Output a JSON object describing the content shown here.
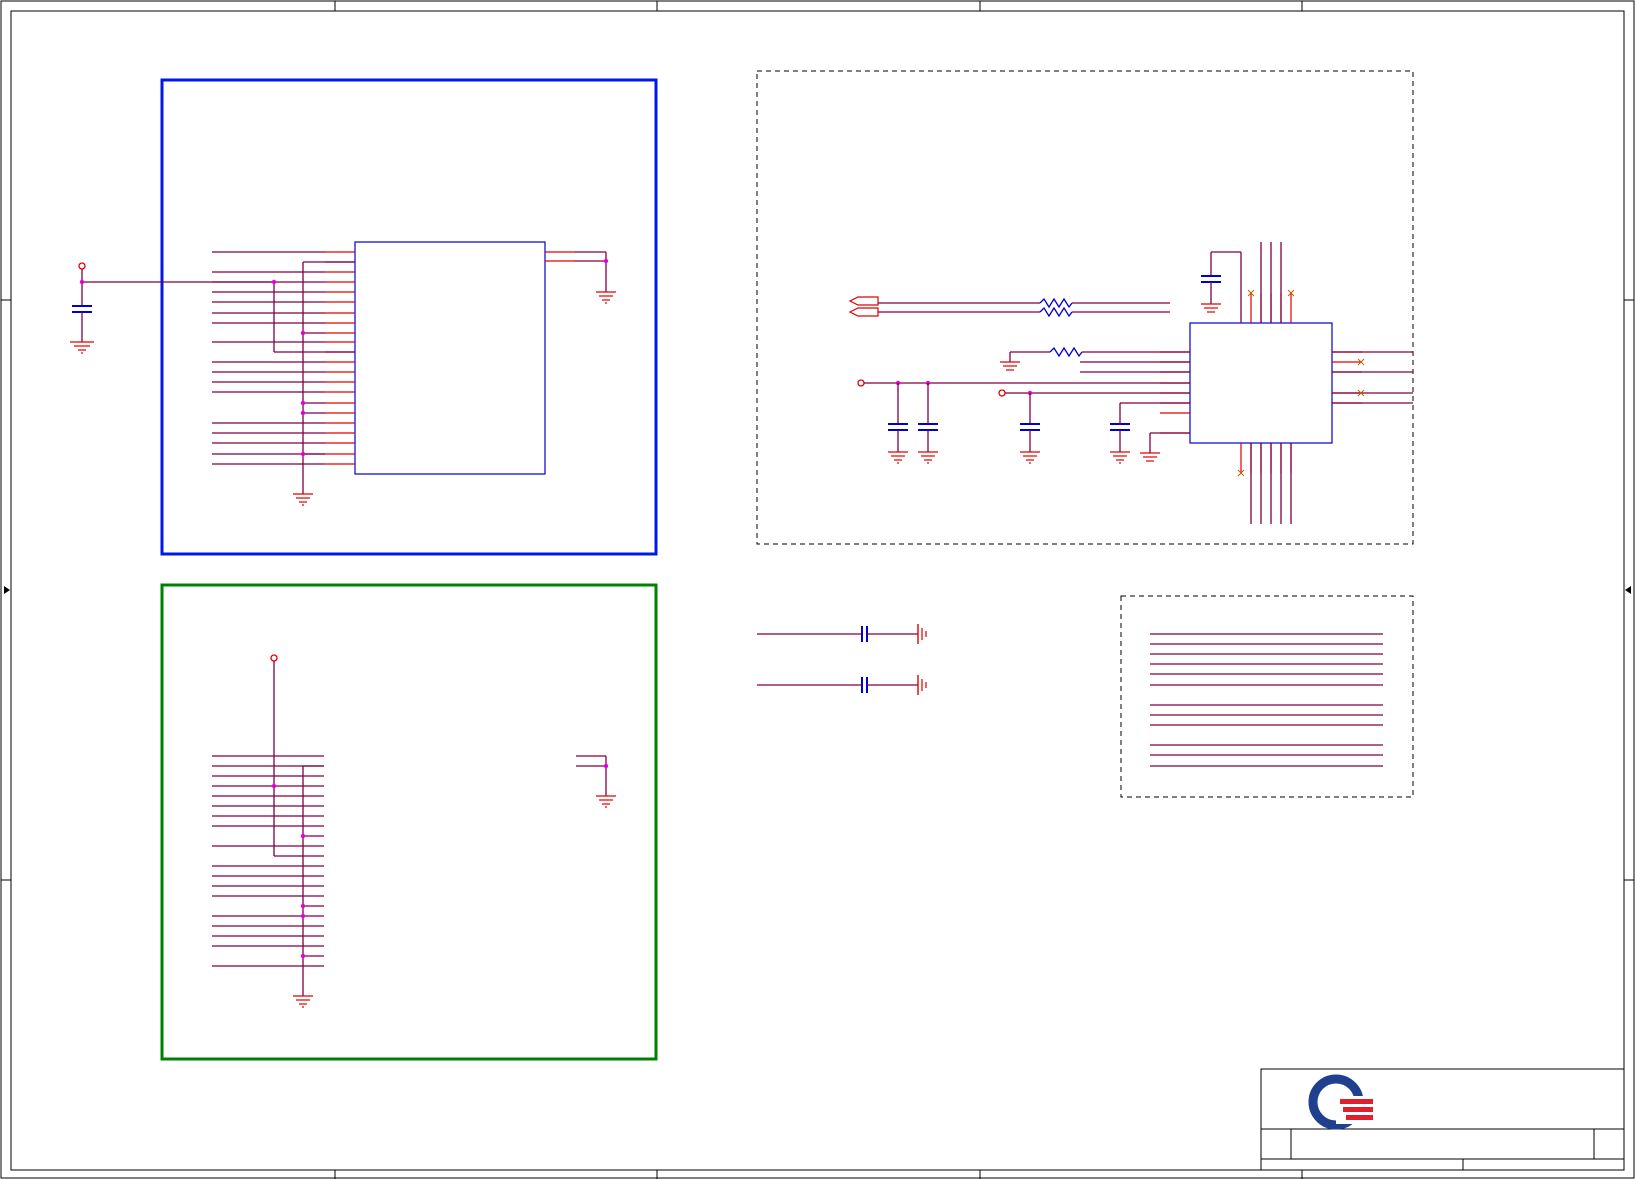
{
  "sheet": {
    "title": "",
    "zone_labels_top": [],
    "zone_labels_side": []
  },
  "colors": {
    "border": "#000000",
    "wire": "#800040",
    "pin": "#e00000",
    "component": "#0000d0",
    "junction": "#e000e0",
    "block_blue": "#0018e8",
    "block_green": "#008000",
    "ground": "#e00000",
    "no_connect": "#c06000",
    "logo_blue": "#1f3f8f",
    "logo_red": "#e0202f"
  },
  "icons": {
    "logo": "company-logo-icon",
    "ground": "ground-icon",
    "capacitor": "capacitor-icon",
    "resistor": "resistor-icon",
    "no_connect": "no-connect-icon",
    "power_port": "power-port-icon",
    "offpage_connector": "offpage-connector-icon"
  },
  "blocks": {
    "upper_left": {
      "style": "solid",
      "color": "blue"
    },
    "lower_left": {
      "style": "solid",
      "color": "green"
    },
    "upper_right": {
      "style": "dashed"
    },
    "lower_right": {
      "style": "dashed"
    }
  },
  "title_block": {
    "logo": "company-logo-icon",
    "fields": []
  }
}
